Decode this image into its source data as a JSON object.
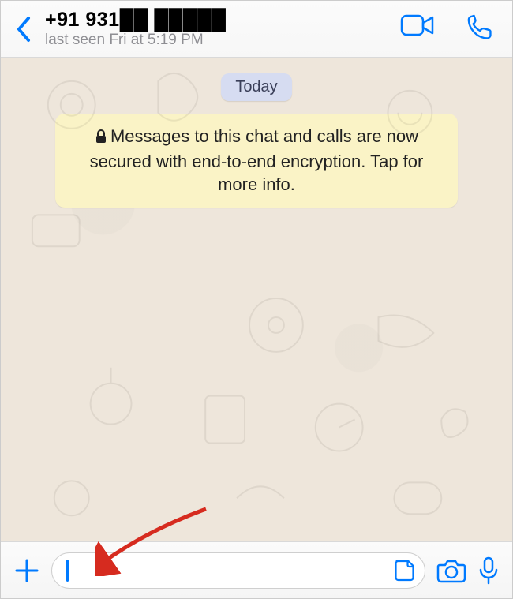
{
  "header": {
    "contact_name": "+91 931██ █████",
    "last_seen": "last seen Fri at 5:19 PM"
  },
  "chat": {
    "date_label": "Today",
    "encryption_notice": "Messages to this chat and calls are now secured with end-to-end encryption. Tap for more info."
  },
  "composer": {
    "input_value": "",
    "placeholder": ""
  },
  "colors": {
    "accent": "#007AFF",
    "chat_bg": "#eee6db",
    "banner_bg": "#faf3c6",
    "date_pill_bg": "#d6dcf1"
  },
  "icons": {
    "back": "chevron-left",
    "video": "video-camera",
    "call": "phone",
    "plus": "plus",
    "sticker": "sticker",
    "camera": "camera",
    "mic": "microphone",
    "lock": "lock"
  }
}
